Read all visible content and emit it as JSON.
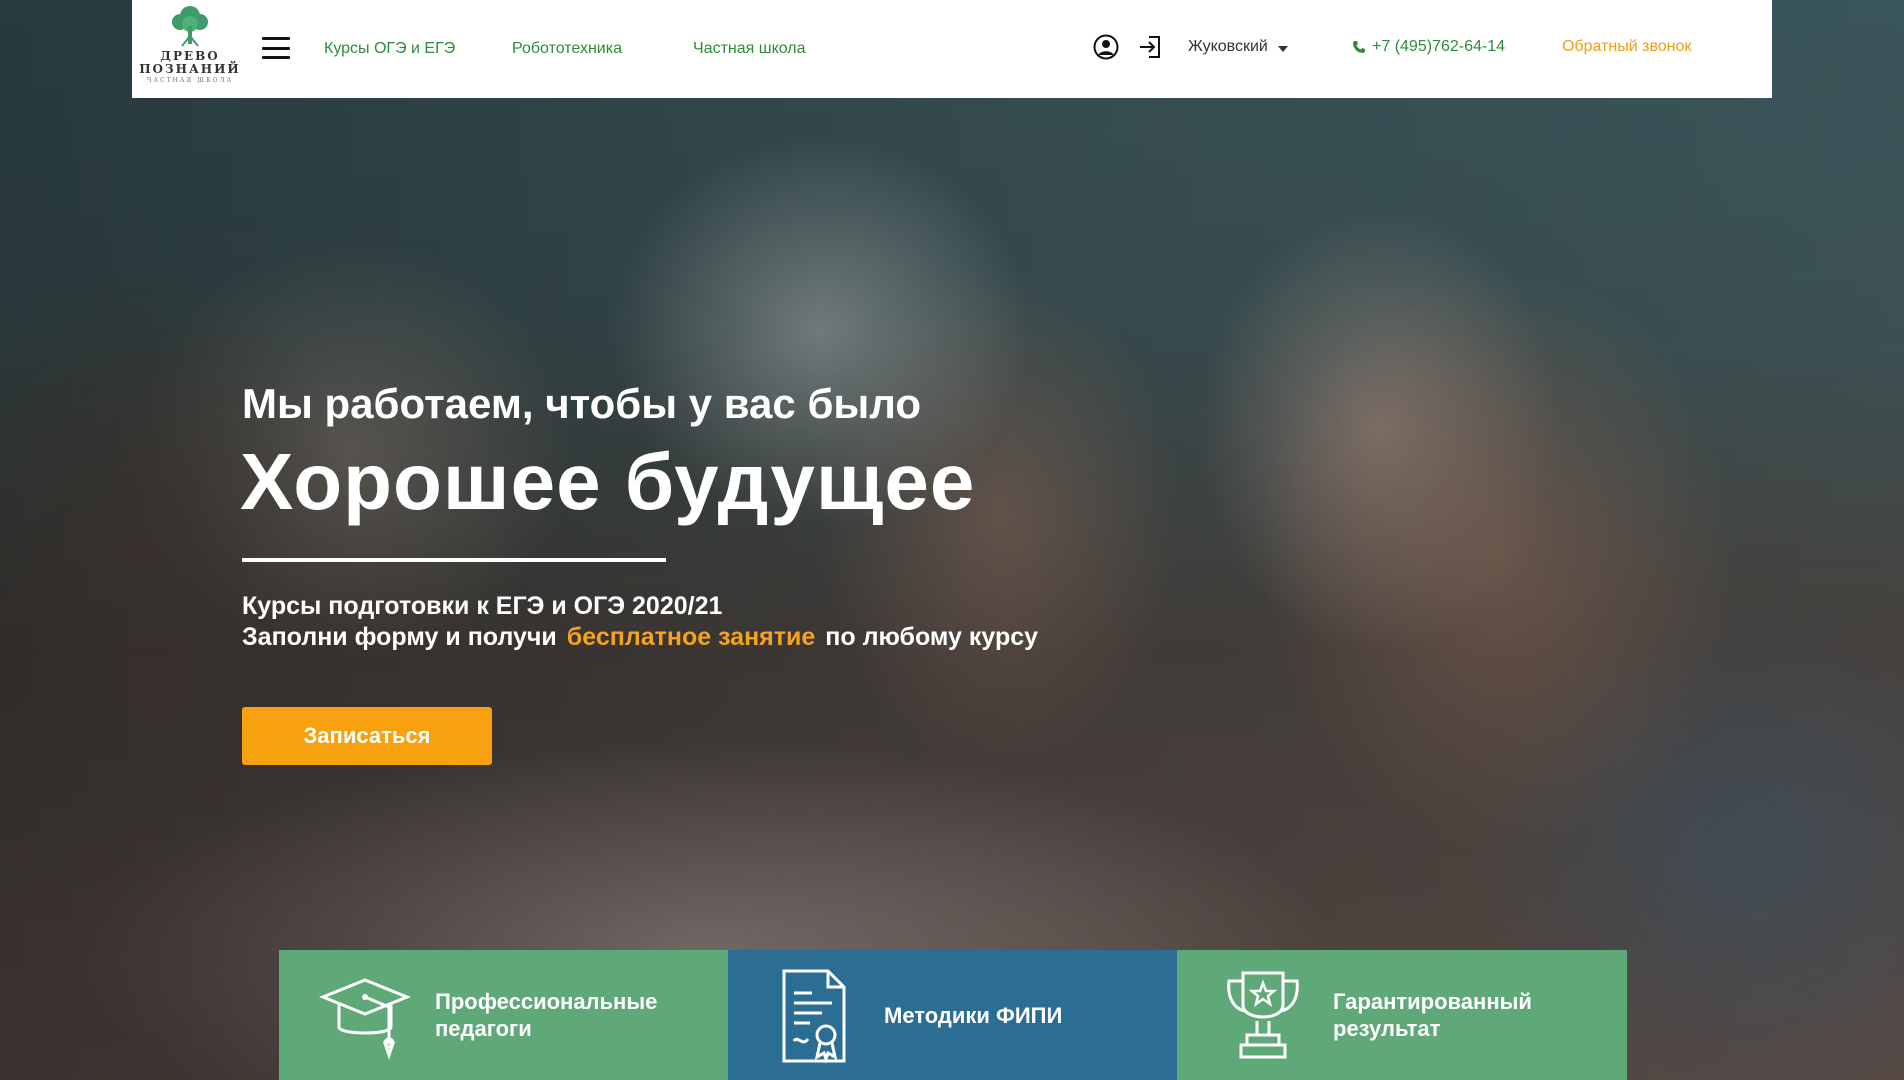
{
  "header": {
    "logo": {
      "line1": "ДРЕВО",
      "line2": "ПОЗНАНИЙ",
      "line3": "ЧАСТНАЯ ШКОЛА"
    },
    "nav": [
      {
        "label": "Курсы ОГЭ и ЕГЭ"
      },
      {
        "label": "Робототехника"
      },
      {
        "label": "Частная школа"
      }
    ],
    "city": "Жуковский",
    "phone": "+7 (495)762-64-14",
    "callback": "Обратный звонок"
  },
  "hero": {
    "pre_title": "Мы работаем, чтобы у вас было",
    "title": "Хорошее будущее",
    "subtitle_line1": "Курсы подготовки к ЕГЭ и ОГЭ 2020/21",
    "subtitle_line2_start": "Заполни форму и получи",
    "subtitle_line2_accent": "бесплатное занятие",
    "subtitle_line2_end": "по любому курсу",
    "cta_label": "Записаться"
  },
  "features": [
    {
      "label": "Профессиональные\nпедагоги",
      "icon": "graduation-cap-icon"
    },
    {
      "label": "Методики ФИПИ",
      "icon": "certificate-document-icon"
    },
    {
      "label": "Гарантированный\nрезультат",
      "icon": "trophy-icon"
    }
  ],
  "colors": {
    "nav_green": "#2e8b3a",
    "accent_orange": "#f7a010",
    "feature_green": "#5fa878",
    "feature_blue": "#2c6d93"
  }
}
